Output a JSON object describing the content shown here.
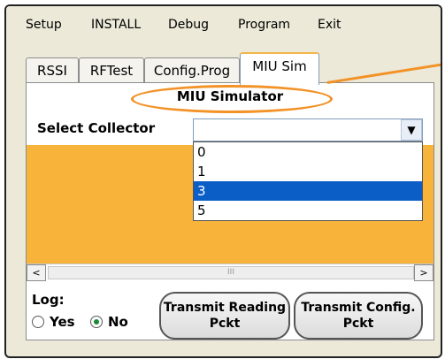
{
  "menu": {
    "items": [
      "Setup",
      "INSTALL",
      "Debug",
      "Program",
      "Exit"
    ]
  },
  "tabs": [
    "RSSI",
    "RFTest",
    "Config.Prog",
    "MIU Sim"
  ],
  "active_tab": "MIU Sim",
  "title": "MIU Simulator",
  "collector": {
    "label": "Select Collector",
    "value": "",
    "options": [
      "0",
      "1",
      "3",
      "5"
    ],
    "selected_index": 2
  },
  "scroll": {
    "left": "<",
    "right": ">",
    "thumb": "III"
  },
  "log": {
    "label": "Log:",
    "yes": "Yes",
    "no": "No",
    "selected": "No"
  },
  "buttons": {
    "transmit_reading": "Transmit Reading Pckt",
    "transmit_config": "Transmit Config. Pckt"
  },
  "colors": {
    "list_bg": "#f8b33b",
    "callout": "#f29227",
    "selection": "#0a5ec6"
  }
}
